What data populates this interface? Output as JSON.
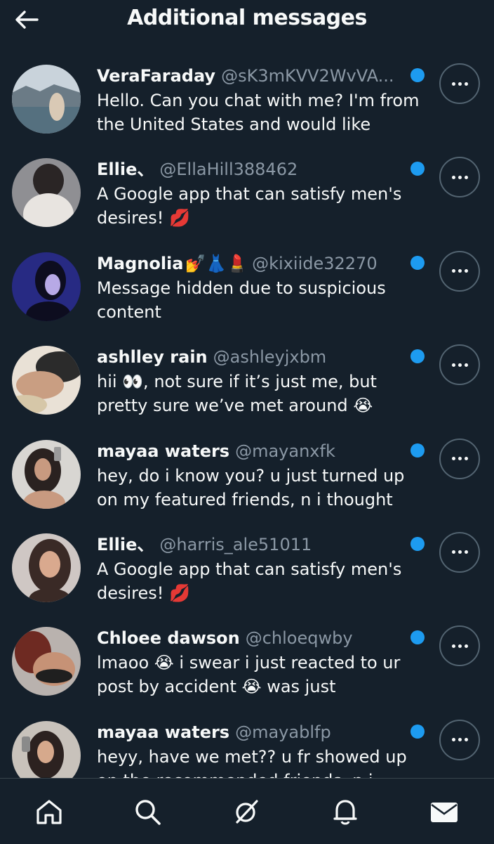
{
  "header": {
    "title": "Additional messages",
    "back_icon": "arrow-left-icon"
  },
  "colors": {
    "background": "#15202b",
    "text": "#f7f9f9",
    "muted": "#8b98a5",
    "unread_dot": "#1d9bf0",
    "divider": "#38444d"
  },
  "messages": [
    {
      "name": "VeraFaraday",
      "handle": "@sK3mKVV2WvVA...",
      "emoji": "",
      "preview": "Hello. Can you chat with me? I'm from the United States and would like",
      "unread": true
    },
    {
      "name": "Ellie、",
      "handle": "@EllaHill388462",
      "emoji": "",
      "preview": "A Google app that can satisfy men's desires! 💋",
      "unread": true
    },
    {
      "name": "Magnolia",
      "handle": "@kixiide32270",
      "emoji": "💅👗💄",
      "preview": "Message hidden due to suspicious content",
      "unread": true
    },
    {
      "name": "ashlley rain",
      "handle": "@ashleyjxbm",
      "emoji": "",
      "preview": "hii 👀, not sure if it’s just me, but pretty sure we’ve met around 😭",
      "unread": true
    },
    {
      "name": "mayaa waters",
      "handle": "@mayanxfk",
      "emoji": "",
      "preview": "hey, do i know you? u just turned up on my featured friends, n i thought",
      "unread": true
    },
    {
      "name": "Ellie、",
      "handle": "@harris_ale51011",
      "emoji": "",
      "preview": "A Google app that can satisfy men's desires! 💋",
      "unread": true
    },
    {
      "name": "Chloee dawson",
      "handle": "@chloeqwby",
      "emoji": "",
      "preview": "lmaoo 😭 i swear i just reacted to ur post by accident 😭 was just",
      "unread": true
    },
    {
      "name": "mayaa waters",
      "handle": "@mayablfp",
      "emoji": "",
      "preview": "heyy, have we met?? u fr showed up on the recommended friends, n i",
      "unread": true
    }
  ],
  "tabbar": {
    "items": [
      "home-icon",
      "search-icon",
      "grok-icon",
      "notifications-bell-icon",
      "messages-envelope-icon"
    ]
  }
}
